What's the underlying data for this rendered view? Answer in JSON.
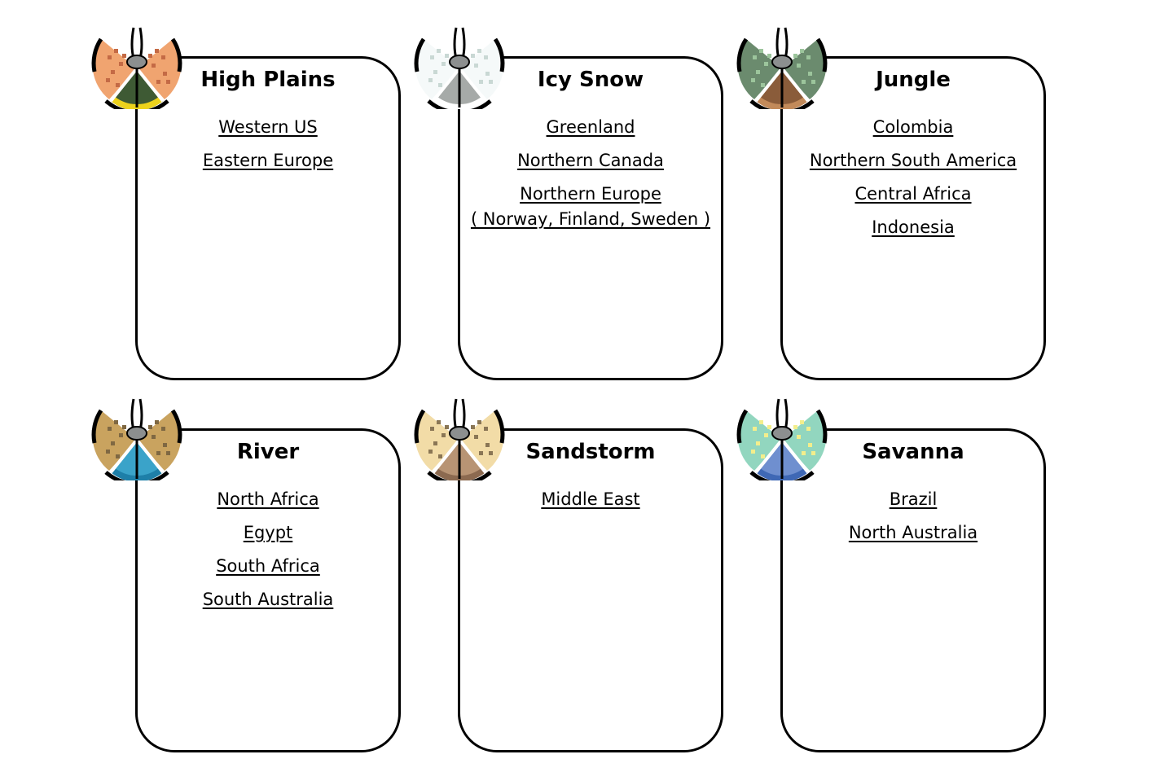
{
  "biomes": [
    {
      "title": "High Plains",
      "icon": "high-plains-emblem-icon",
      "colors": {
        "wing": "#f0a470",
        "pattern": "#c46a45",
        "ground": "#3e5a34",
        "band": "#ecd21c"
      },
      "links": [
        [
          "Western US"
        ],
        [
          "Eastern Europe"
        ]
      ]
    },
    {
      "title": "Icy Snow",
      "icon": "icy-snow-emblem-icon",
      "colors": {
        "wing": "#f5f9f9",
        "pattern": "#c9d8d4",
        "ground": "#a6aaa8",
        "band": "#ffffff"
      },
      "links": [
        [
          "Greenland"
        ],
        [
          "Northern Canada"
        ],
        [
          "Northern Europe",
          "( Norway, Finland, Sweden )"
        ]
      ]
    },
    {
      "title": "Jungle",
      "icon": "jungle-emblem-icon",
      "colors": {
        "wing": "#6b8b6e",
        "pattern": "#9cc59c",
        "ground": "#8a5c3a",
        "band": "#c28a5a"
      },
      "links": [
        [
          "Colombia"
        ],
        [
          "Northern South America"
        ],
        [
          "Central Africa"
        ],
        [
          "Indonesia"
        ]
      ]
    },
    {
      "title": "River",
      "icon": "river-emblem-icon",
      "colors": {
        "wing": "#c9a35f",
        "pattern": "#7f6842",
        "ground": "#3aa3c9",
        "band": "#1e7fa8"
      },
      "links": [
        [
          "North Africa"
        ],
        [
          "Egypt"
        ],
        [
          "South Africa"
        ],
        [
          "South Australia"
        ]
      ]
    },
    {
      "title": "Sandstorm",
      "icon": "sandstorm-emblem-icon",
      "colors": {
        "wing": "#f2dca7",
        "pattern": "#8a7655",
        "ground": "#b89474",
        "band": "#8c6a50"
      },
      "links": [
        [
          "Middle East"
        ]
      ]
    },
    {
      "title": "Savanna",
      "icon": "savanna-emblem-icon",
      "colors": {
        "wing": "#92d6bf",
        "pattern": "#f3ee8c",
        "ground": "#6f8fcf",
        "band": "#3f68b5"
      },
      "links": [
        [
          "Brazil"
        ],
        [
          "North Australia"
        ]
      ]
    }
  ]
}
